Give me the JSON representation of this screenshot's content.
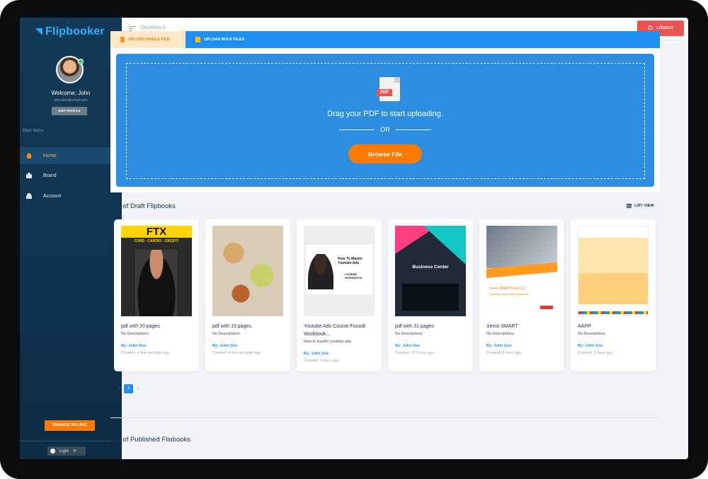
{
  "sidebar": {
    "logo": "Flipbooker",
    "welcome": "Welcome, John",
    "email": "john.doe@email.com",
    "edit_profile": "EDIT PROFILE",
    "main_menu": "Main Menu",
    "items": [
      {
        "label": "Home",
        "icon": "home-icon",
        "active": true
      },
      {
        "label": "Brand",
        "icon": "brand-icon",
        "active": false
      },
      {
        "label": "Account",
        "icon": "user-icon",
        "active": false
      }
    ],
    "manage_billing": "MANAGE BILLING",
    "theme_label": "Light"
  },
  "topbar": {
    "breadcrumb": "Dashboard",
    "logout": "LOGOUT"
  },
  "upload": {
    "tab_single": "UPLOAD SINGLE FILE",
    "tab_bulk": "UPLOAD BULK FILES",
    "pdf_tag": "PDF",
    "drag_text": "Drag your PDF to start uploading.",
    "or": "OR",
    "browse": "Browse File"
  },
  "drafts": {
    "title": "List of Draft Flipbooks",
    "list_view": "LIST VIEW",
    "cards": [
      {
        "title": "pdf with 20 pages",
        "desc": "No Descriptions",
        "author": "By: John Doe",
        "created": "Created: a few seconds ago",
        "cover_text": "FTX",
        "cover_sub": "CORE · CARDIO · CIRQFIT"
      },
      {
        "title": "pdf with 15 pages",
        "desc": "No Descriptions",
        "author": "By: John Doe",
        "created": "Created: a few seconds ago"
      },
      {
        "title": "Youtube Ads Course Foundr Workbook...",
        "desc": "How to master youtube ads",
        "author": "By: John Doe",
        "created": "Created: 3 days ago",
        "cover_text": "How To Master Youtube Ads",
        "cover_sub": "COURSE WORKBOOK"
      },
      {
        "title": "pdf with 31 pages",
        "desc": "No Descriptions",
        "author": "By: John Doe",
        "created": "Created: 10 hours ago",
        "cover_text": "Business Center"
      },
      {
        "title": "Xerox SMART",
        "desc": "No Descriptions",
        "author": "By: John Doe",
        "created": "Created: 5 days ago",
        "cover_text": "Xerox SMARTsend 3.0",
        "cover_sub": "Scanning made fast and secure"
      },
      {
        "title": "AAPP",
        "desc": "No Descriptions",
        "author": "By: John Doe",
        "created": "Created: 5 days ago"
      }
    ]
  },
  "pagination": {
    "prev": "‹",
    "current": "1",
    "next": "›"
  },
  "published": {
    "title": "List of Published Flipbooks"
  },
  "colors": {
    "accent": "#ff7a00",
    "primary": "#1f8ff0",
    "sidebar": "#123a57",
    "danger": "#ef5350"
  }
}
